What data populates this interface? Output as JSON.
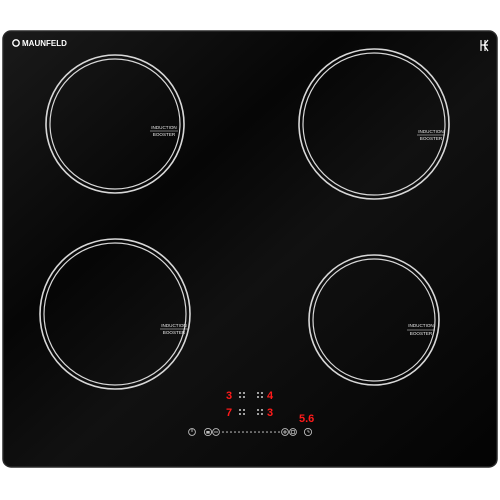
{
  "brand": "MAUNFELD",
  "zones": [
    {
      "id": "zone-top-left",
      "line1": "INDUCTION",
      "line2": "BOOSTER"
    },
    {
      "id": "zone-top-right",
      "line1": "INDUCTION",
      "line2": "BOOSTER"
    },
    {
      "id": "zone-bottom-left",
      "line1": "INDUCTION",
      "line2": "BOOSTER"
    },
    {
      "id": "zone-bottom-right",
      "line1": "INDUCTION",
      "line2": "BOOSTER"
    }
  ],
  "display": {
    "top_left_level": "3",
    "top_right_level": "4",
    "bottom_left_level": "7",
    "bottom_right_level": "3",
    "timer": "5.6"
  },
  "icons": {
    "corner_symbol": "induction-symbol-icon",
    "power": "power-icon",
    "lock": "lock-icon",
    "minus": "minus-icon",
    "plus": "plus-icon",
    "timer": "timer-icon",
    "slider": "power-slider"
  },
  "colors": {
    "glass": "#060606",
    "ring": "#d8d8d8",
    "display_red": "#ff1a1a",
    "label": "#e6e6e6"
  }
}
